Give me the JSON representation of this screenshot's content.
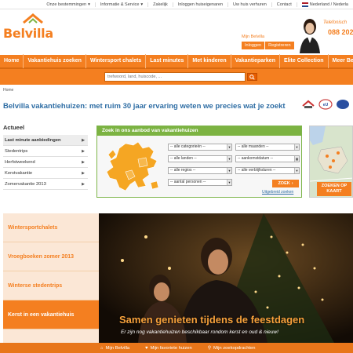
{
  "topbar": {
    "links": [
      "Onze bestemmingen",
      "Informatie & Service",
      "Zakelijk",
      "Inloggen huiseigenaren",
      "Uw huis verhuren",
      "Contact",
      "Nederland / Nederla"
    ]
  },
  "header": {
    "logo": "Belvilla",
    "my_belvilla": "Mijn Belvilla",
    "login_label": "Inloggen",
    "register_label": "Registreren",
    "phone_label": "Telefonisch",
    "phone_number": "088 202"
  },
  "mainnav": {
    "items": [
      "Home",
      "Vakantiehuis zoeken",
      "Wintersport chalets",
      "Last minutes",
      "Met kinderen",
      "Vakantieparken",
      "Elite Collection",
      "Meer Bel"
    ]
  },
  "search": {
    "placeholder": "trefwoord, land, huiscode, ..."
  },
  "breadcrumb": "Home",
  "headline": "Belvilla vakantiehuizen: met ruim 30 jaar ervaring weten we precies wat je zoekt",
  "sidebar": {
    "title": "Actueel",
    "items": [
      "Last minute aanbiedingen",
      "Stedentrips",
      "Herfstweekend",
      "Kerstvakantie",
      "Zomervakantie 2013"
    ]
  },
  "search_panel": {
    "title": "Zoek in ons aanbod van vakantiehuizen",
    "selects": {
      "categories": "-- alle categorieën --",
      "months": "-- alle maanden --",
      "countries": "-- alle landen --",
      "arrival": "-- aankomstdatum --",
      "regions": "-- alle regios --",
      "duration": "-- alle verblijfsduren --",
      "persons": "-- aantal personen --"
    },
    "search_button": "ZOEK",
    "advanced_link": "Uitgebreid zoeken"
  },
  "right_map": {
    "button": "ZOEKEN OP KAART"
  },
  "promo": {
    "items": [
      "Wintersportchalets",
      "Vroegboeken zomer 2013",
      "Winterse stedentrips",
      "Kerst in een vakantiehuis"
    ],
    "title": "Samen genieten tijdens de feestdagen",
    "subtitle": "Er zijn nog vakantiehuizen beschikbaar rondom kerst en oud & nieuw!"
  },
  "bottombar": {
    "items": [
      "Mijn Belvilla",
      "Mijn favoriete huizen",
      "Mijn zoekopdrachten"
    ]
  },
  "colors": {
    "brand_orange": "#f47f20",
    "link_blue": "#2e6da4",
    "panel_green": "#7cb342"
  }
}
